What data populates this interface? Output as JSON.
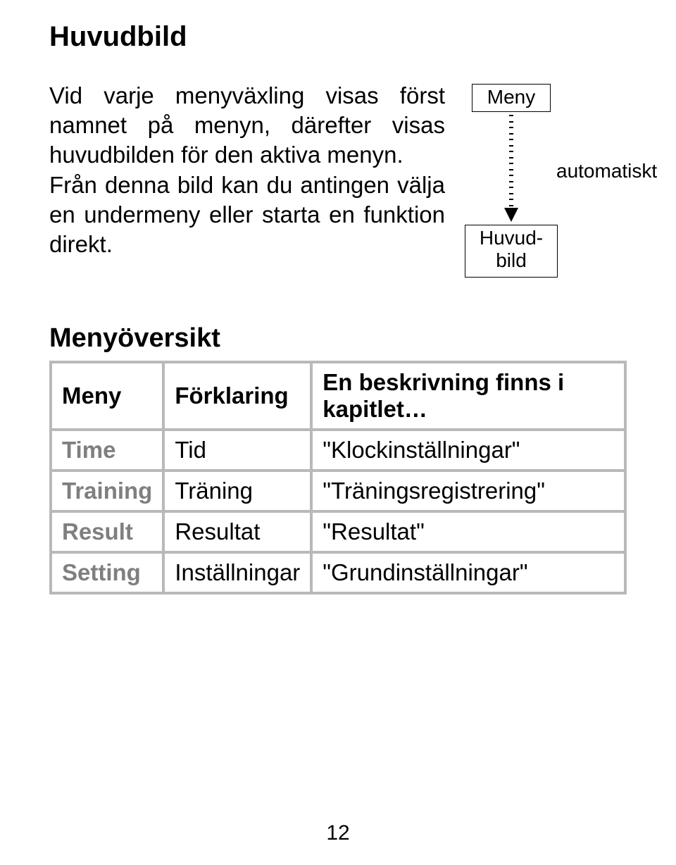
{
  "title": "Huvudbild",
  "paragraphs": {
    "p1": "Vid varje menyväxling visas först namnet på menyn, därefter visas huvudbilden för den aktiva menyn.",
    "p2": "Från denna bild kan du antingen välja en undermeny eller starta en funktion direkt."
  },
  "diagram": {
    "top_box": "Meny",
    "bottom_box": "Huvud-\nbild",
    "arrow_label": "automatiskt"
  },
  "subtitle": "Menyöversikt",
  "table": {
    "headers": {
      "c1": "Meny",
      "c2": "Förklaring",
      "c3": "En beskrivning finns i kapitlet…"
    },
    "rows": [
      {
        "menu": "Time",
        "expl": "Tid",
        "desc": "\"Klockinställningar\""
      },
      {
        "menu": "Training",
        "expl": "Träning",
        "desc": "\"Träningsregistrering\""
      },
      {
        "menu": "Result",
        "expl": "Resultat",
        "desc": "\"Resultat\""
      },
      {
        "menu": "Setting",
        "expl": "Inställningar",
        "desc": "\"Grundinställningar\""
      }
    ]
  },
  "page_number": "12"
}
